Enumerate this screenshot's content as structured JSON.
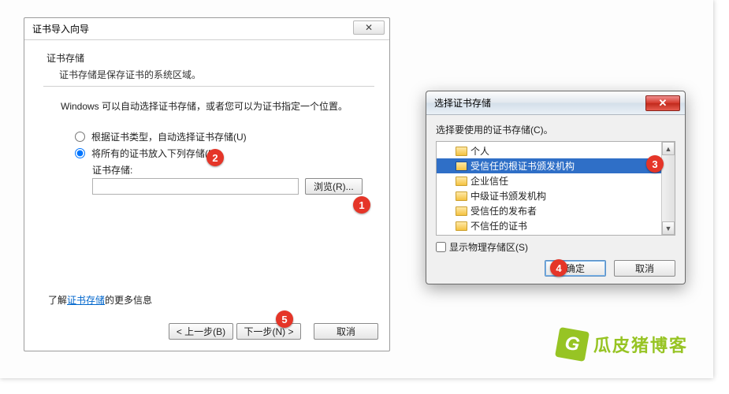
{
  "wizard": {
    "title": "证书导入向导",
    "section_title": "证书存储",
    "section_sub": "证书存储是保存证书的系统区域。",
    "info_line": "Windows 可以自动选择证书存储，或者您可以为证书指定一个位置。",
    "radio_auto": "根据证书类型，自动选择证书存储(U)",
    "radio_manual": "将所有的证书放入下列存储(P)",
    "store_label": "证书存储:",
    "store_value": "",
    "browse_btn": "浏览(R)...",
    "learn_prefix": "了解",
    "learn_link": "证书存储",
    "learn_suffix": "的更多信息",
    "back_btn": "< 上一步(B)",
    "next_btn": "下一步(N) >",
    "cancel_btn": "取消",
    "close_glyph": "✕"
  },
  "picker": {
    "title": "选择证书存储",
    "prompt": "选择要使用的证书存储(C)。",
    "items": [
      "个人",
      "受信任的根证书颁发机构",
      "企业信任",
      "中级证书颁发机构",
      "受信任的发布者",
      "不信任的证书"
    ],
    "selected_index": 1,
    "show_physical": "显示物理存储区(S)",
    "ok_btn": "确定",
    "cancel_btn": "取消",
    "close_glyph": "✕"
  },
  "badges": {
    "b1": "1",
    "b2": "2",
    "b3": "3",
    "b4": "4",
    "b5": "5"
  },
  "brand": {
    "mark": "G",
    "name": "瓜皮猪博客"
  }
}
